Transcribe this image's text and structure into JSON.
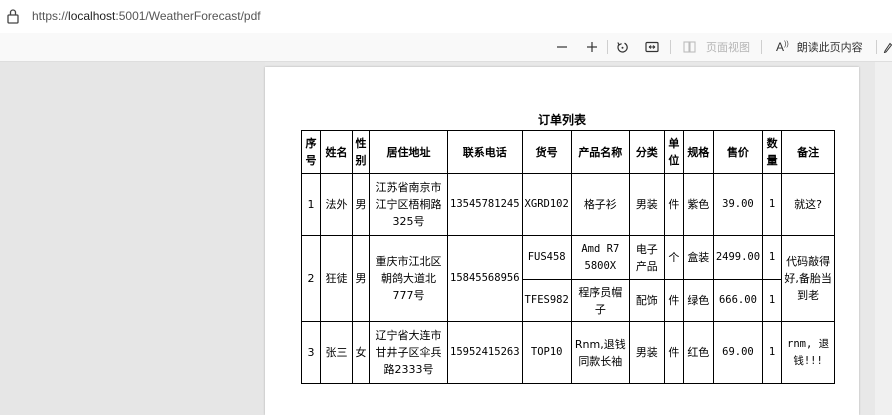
{
  "browser": {
    "url_prefix": "https://",
    "url_host": "localhost",
    "url_rest": ":5001/WeatherForecast/pdf"
  },
  "toolbar": {
    "zoom_out_icon": "minus-icon",
    "zoom_in_icon": "plus-icon",
    "rotate_icon": "rotate-icon",
    "fit_icon": "fit-page-icon",
    "page_view_label": "页面视图",
    "read_aloud_label": "朗读此页内容"
  },
  "document": {
    "title": "订单列表",
    "headers": {
      "seq": "序号",
      "name": "姓名",
      "gender": "性别",
      "address": "居住地址",
      "phone": "联系电话",
      "sku": "货号",
      "product": "产品名称",
      "category": "分类",
      "unit": "单位",
      "spec": "规格",
      "price": "售价",
      "qty": "数量",
      "remark": "备注"
    },
    "rows": [
      {
        "seq": "1",
        "name": "法外",
        "gender": "男",
        "address": "江苏省南京市江宁区梧桐路325号",
        "phone": "13545781245",
        "remark": "就这?",
        "items": [
          {
            "sku": "XGRD102",
            "product": "格子衫",
            "category": "男装",
            "unit": "件",
            "spec": "紫色",
            "price": "39.00",
            "qty": "1"
          }
        ]
      },
      {
        "seq": "2",
        "name": "狂徒",
        "gender": "男",
        "address": "重庆市江北区朝鸽大道北777号",
        "phone": "15845568956",
        "remark": "代码敲得好,备胎当到老",
        "items": [
          {
            "sku": "FUS458",
            "product": "Amd R7 5800X",
            "category": "电子产品",
            "unit": "个",
            "spec": "盒装",
            "price": "2499.00",
            "qty": "1"
          },
          {
            "sku": "TFES982",
            "product": "程序员帽子",
            "category": "配饰",
            "unit": "件",
            "spec": "绿色",
            "price": "666.00",
            "qty": "1"
          }
        ]
      },
      {
        "seq": "3",
        "name": "张三",
        "gender": "女",
        "address": "辽宁省大连市甘井子区伞兵路2333号",
        "phone": "15952415263",
        "remark": "rnm, 退钱!!!",
        "items": [
          {
            "sku": "TOP10",
            "product": "Rnm,退钱同款长袖",
            "category": "男装",
            "unit": "件",
            "spec": "红色",
            "price": "69.00",
            "qty": "1"
          }
        ]
      }
    ]
  }
}
